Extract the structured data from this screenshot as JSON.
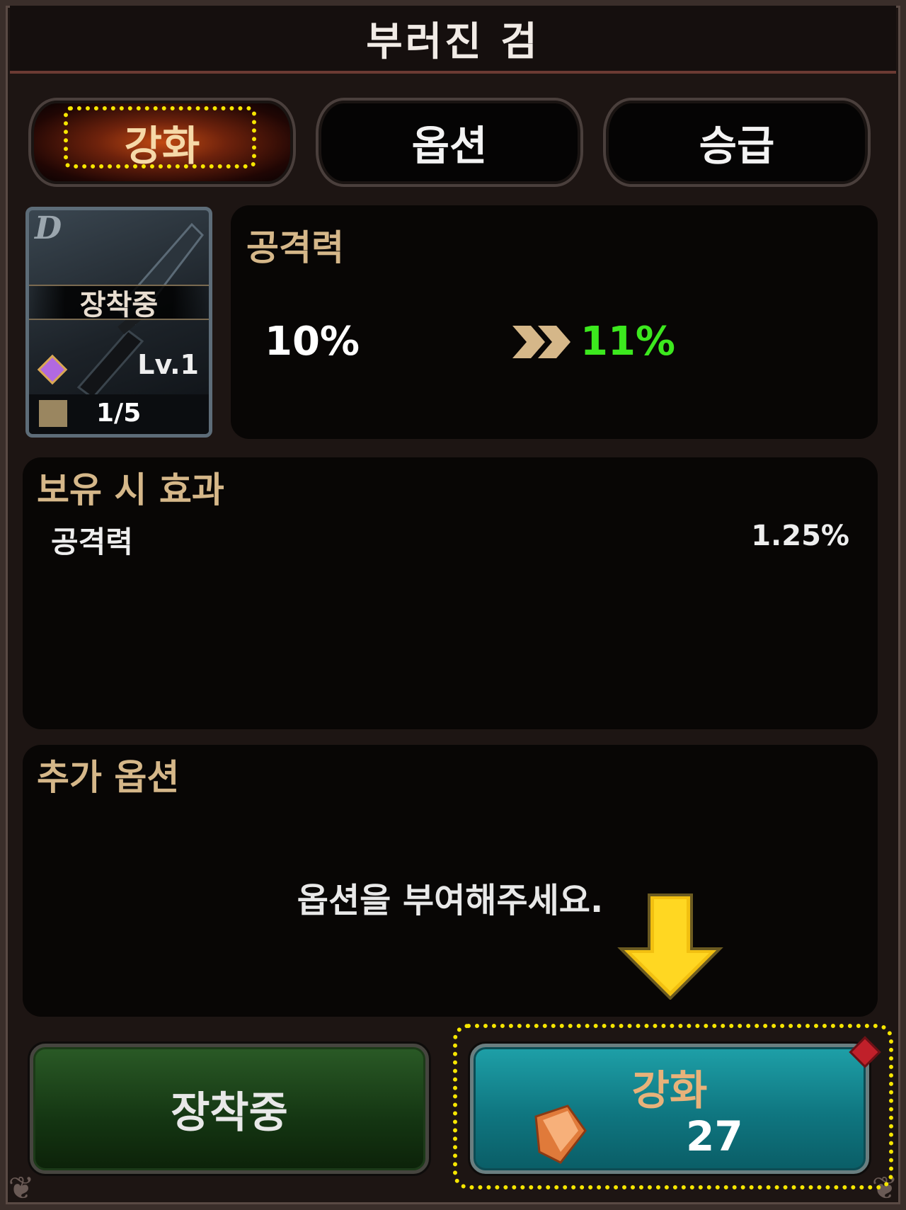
{
  "window": {
    "title": "부러진 검"
  },
  "tabs": [
    {
      "label": "강화",
      "active": true
    },
    {
      "label": "옵션",
      "active": false
    },
    {
      "label": "승급",
      "active": false
    }
  ],
  "item": {
    "grade": "D",
    "status": "장착중",
    "level": "Lv.1",
    "count": "1/5",
    "icon": "broken-sword-icon"
  },
  "stat": {
    "name": "공격력",
    "current": "10%",
    "next": "11%"
  },
  "owned_effect": {
    "title": "보유 시 효과",
    "rows": [
      {
        "name": "공격력",
        "value": "1.25%"
      }
    ]
  },
  "extra_option": {
    "title": "추가 옵션",
    "empty_message": "옵션을 부여해주세요."
  },
  "buttons": {
    "equipped_label": "장착중",
    "enhance_label": "강화",
    "enhance_cost": "27"
  },
  "colors": {
    "accent_gold": "#d5b789",
    "increase_green": "#3ce81e",
    "highlight_yellow": "#f6e600",
    "enhance_teal": "#0f7680",
    "equipped_green": "#143512"
  }
}
